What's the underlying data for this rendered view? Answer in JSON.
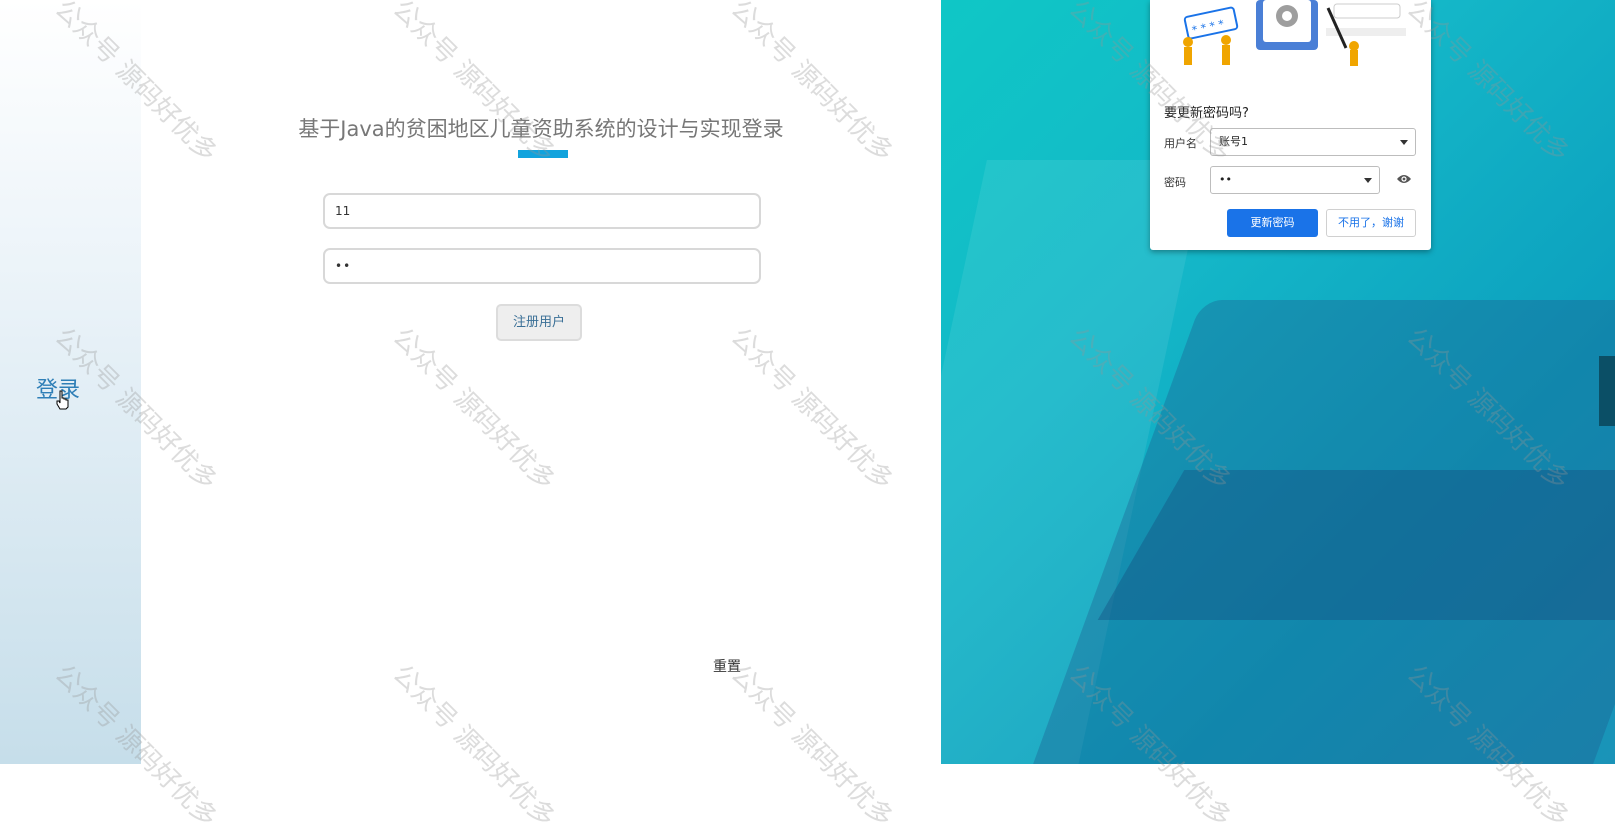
{
  "sidebar": {
    "login_link": "登录"
  },
  "login": {
    "title": "基于Java的贫困地区儿童资助系统的设计与实现登录",
    "username_value": "11",
    "password_value": "••",
    "register_button": "注册用户",
    "reset_link": "重置"
  },
  "password_dialog": {
    "heading": "要更新密码吗?",
    "username_label": "用户名",
    "username_value": "账号1",
    "password_label": "密码",
    "password_value": "••",
    "illustration_text": "* * * *",
    "update_button": "更新密码",
    "decline_button": "不用了，谢谢",
    "accent_color": "#1a73e8"
  },
  "watermark": {
    "text": "公众号 源码好优多"
  },
  "colors": {
    "title_underline": "#12a3dd",
    "right_background": "#14b7c8"
  }
}
